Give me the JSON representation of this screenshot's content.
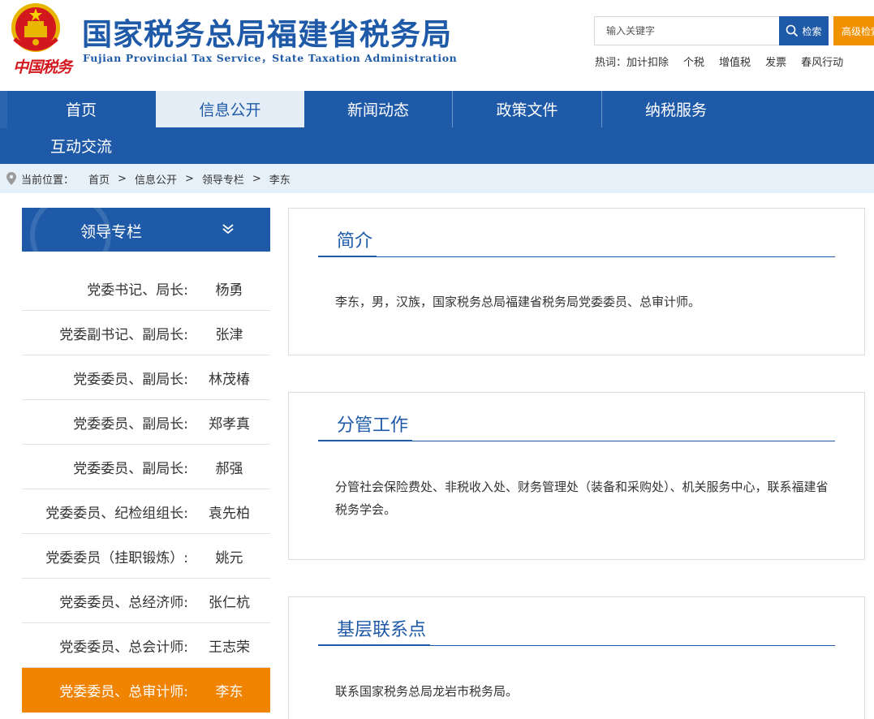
{
  "header": {
    "site_title": "国家税务总局福建省税务局",
    "site_subtitle": "Fujian Provincial Tax Service，State Taxation Administration",
    "china_tax_logo_text": "中国税务",
    "search_placeholder": "输入关键字",
    "search_button": "检索",
    "advanced_search_button": "高级检索",
    "hot_label": "热词：",
    "hot_words": [
      "加计扣除",
      "个税",
      "增值税",
      "发票",
      "春风行动"
    ]
  },
  "nav": {
    "items": [
      "首页",
      "信息公开",
      "新闻动态",
      "政策文件",
      "纳税服务",
      "互动交流"
    ],
    "active_index": 1
  },
  "breadcrumb": {
    "label": "当前位置：",
    "items": [
      "首页",
      "信息公开",
      "领导专栏",
      "李东"
    ],
    "separator": ">"
  },
  "sidebar": {
    "title": "领导专栏",
    "leaders": [
      {
        "role": "党委书记、局长:",
        "name": "杨勇"
      },
      {
        "role": "党委副书记、副局长:",
        "name": "张津"
      },
      {
        "role": "党委委员、副局长:",
        "name": "林茂椿"
      },
      {
        "role": "党委委员、副局长:",
        "name": "郑孝真"
      },
      {
        "role": "党委委员、副局长:",
        "name": "郝强"
      },
      {
        "role": "党委委员、纪检组组长:",
        "name": "袁先柏"
      },
      {
        "role": "党委委员（挂职锻炼）:",
        "name": "姚元"
      },
      {
        "role": "党委委员、总经济师:",
        "name": "张仁杭"
      },
      {
        "role": "党委委员、总会计师:",
        "name": "王志荣"
      },
      {
        "role": "党委委员、总审计师:",
        "name": "李东"
      }
    ],
    "active_index": 9
  },
  "content": {
    "sections": [
      {
        "heading": "简介",
        "text": "李东，男，汉族，国家税务总局福建省税务局党委委员、总审计师。"
      },
      {
        "heading": "分管工作",
        "text": "分管社会保险费处、非税收入处、财务管理处（装备和采购处）、机关服务中心，联系福建省税务学会。"
      },
      {
        "heading": "基层联系点",
        "text": "联系国家税务总局龙岩市税务局。"
      }
    ]
  },
  "colors": {
    "brand_blue": "#1e5aa8",
    "accent_orange": "#f08300",
    "logo_red": "#d3171e"
  }
}
